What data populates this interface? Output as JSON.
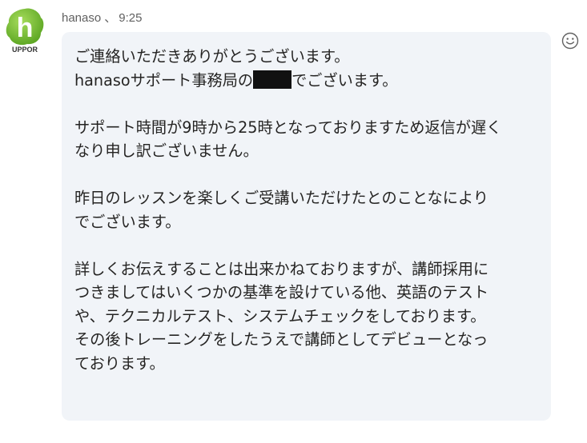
{
  "message": {
    "sender": "hanaso",
    "separator": "、",
    "time": "9:25",
    "avatar": {
      "letter": "h",
      "caption": "UPPOR",
      "icon": "hanaso-support-logo"
    },
    "reaction_icon": "smiley-reaction-icon",
    "body": {
      "line1": "ご連絡いただきありがとうございます。",
      "line2_prefix": "hanasoサポート事務局の",
      "line2_redacted": "",
      "line2_suffix": "でございます。",
      "para2_line1": "サポート時間が9時から25時となっておりますため返信が遅く",
      "para2_line2": "なり申し訳ございません。",
      "para3_line1": "昨日のレッスンを楽しくご受講いただけたとのことなにより",
      "para3_line2": "でございます。",
      "para4_line1": "詳しくお伝えすることは出来かねておりますが、講師採用に",
      "para4_line2": "つきましてはいくつかの基準を設けている他、英語のテスト",
      "para4_line3": "や、テクニカルテスト、システムチェックをしております。",
      "para4_line4": "その後トレーニングをしたうえで講師としてデビューとなっ",
      "para4_line5": "ております。"
    }
  },
  "colors": {
    "bubble_bg": "#f1f4f8",
    "text": "#252423",
    "meta_text": "#616161",
    "logo_green": "#7cc23a"
  }
}
